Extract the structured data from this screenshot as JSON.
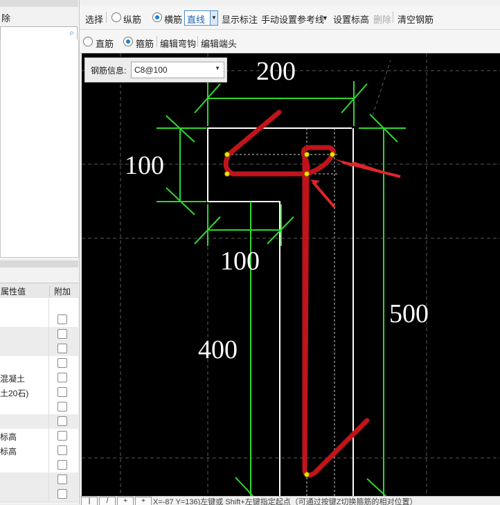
{
  "left_panel": {
    "delete_label": "除",
    "prop_headers": {
      "value": "属性值",
      "extra": "附加"
    },
    "prop_rows": [
      {
        "value": "",
        "alt": false
      },
      {
        "value": "",
        "alt": false
      },
      {
        "value": "",
        "alt": true
      },
      {
        "value": "",
        "alt": true
      },
      {
        "value": "",
        "alt": false
      },
      {
        "value": "混凝土",
        "alt": false
      },
      {
        "value": "土20石)",
        "alt": false
      },
      {
        "value": "",
        "alt": false
      },
      {
        "value": "",
        "alt": true
      },
      {
        "value": "标高",
        "alt": false
      },
      {
        "value": "标高",
        "alt": false
      },
      {
        "value": "",
        "alt": false
      },
      {
        "value": "",
        "alt": true
      },
      {
        "value": "",
        "alt": true
      }
    ]
  },
  "toolbar1": {
    "select": "选择",
    "longitudinal": "纵筋",
    "transverse": "横筋",
    "line_mode": "直线",
    "show_annotation": "显示标注",
    "manual_ref_line": "手动设置参考线",
    "set_elevation": "设置标高",
    "delete": "删除",
    "clear_rebar": "清空钢筋"
  },
  "toolbar2": {
    "straight": "直筋",
    "stirrup": "箍筋",
    "edit_hook": "编辑弯钩",
    "edit_end": "编辑端头"
  },
  "rebar_info": {
    "label": "钢筋信息:",
    "value": "C8@100"
  },
  "dimensions": {
    "top": "200",
    "left": "100",
    "mid": "100",
    "bottom_left": "400",
    "right": "500"
  },
  "status": {
    "text": "X=-87 Y=136)左键或 Shift+左键指定起点（可通过按键Z切换箍筋的相对位置）"
  }
}
